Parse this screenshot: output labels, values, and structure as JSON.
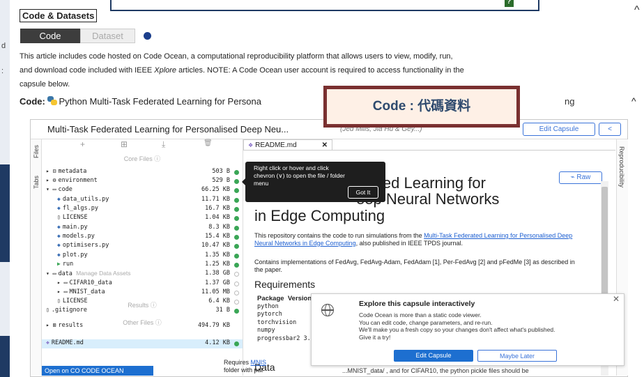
{
  "page": {
    "left_frag_1": "d",
    "left_frag_2": ":",
    "section_title": "Code & Datasets",
    "tabs": {
      "code": "Code",
      "dataset": "Dataset"
    },
    "intro_1": "This article includes code hosted on Code Ocean, a computational reproducibility platform that allows users to view, modify, run,",
    "intro_2a": "and download code included with IEEE ",
    "intro_2b": "Xplore",
    "intro_2c": " articles. NOTE: A Code Ocean user account is required to access functionality in the",
    "intro_3": "capsule below.",
    "code_label": "Code:",
    "code_value": "Python Multi-Task Federated Learning for Persona",
    "code_tail": "ng",
    "overlay_label": "Code : 代碼資料",
    "up_chevron": "^",
    "down_chevron": "^"
  },
  "capsule": {
    "title": "Multi-Task Federated Learning for Personalised Deep Neu...",
    "authors": "(Jed Mills, Jia Hu & Gey...)",
    "edit_capsule": "Edit Capsule",
    "share": "<",
    "rail_files": "Files",
    "rail_tabs": "Tabs",
    "rail_repro": "Reproducibility",
    "open_co": "Open on CO CODE OCEAN"
  },
  "files": {
    "toolbar": [
      "+",
      "⊞",
      "⤓",
      "🗑"
    ],
    "core_label": "Core Files ⓘ",
    "results_label": "Results ⓘ",
    "other_label": "Other Files ⓘ",
    "rows": [
      {
        "icon": "▸ ⊟",
        "name": "metadata",
        "sub": "",
        "size": "503 B",
        "status": "ok",
        "indent": 0
      },
      {
        "icon": "▸ ⚙",
        "name": "environment",
        "sub": "",
        "size": "529 B",
        "status": "ok",
        "indent": 0
      },
      {
        "icon": "▾ ▭",
        "name": "code",
        "sub": "",
        "size": "66.25 KB",
        "status": "ok",
        "indent": 0
      },
      {
        "icon": "◆",
        "name": "data_utils.py",
        "sub": "",
        "size": "11.71 KB",
        "status": "ok",
        "indent": 1,
        "type": "py"
      },
      {
        "icon": "◆",
        "name": "fl_algs.py",
        "sub": "",
        "size": "16.7 KB",
        "status": "ok",
        "indent": 1,
        "type": "py"
      },
      {
        "icon": "▯",
        "name": "LICENSE",
        "sub": "",
        "size": "1.04 KB",
        "status": "ok",
        "indent": 1
      },
      {
        "icon": "◆",
        "name": "main.py",
        "sub": "",
        "size": "8.3 KB",
        "status": "ok",
        "indent": 1,
        "type": "py"
      },
      {
        "icon": "◆",
        "name": "models.py",
        "sub": "",
        "size": "15.4 KB",
        "status": "ok",
        "indent": 1,
        "type": "py"
      },
      {
        "icon": "◆",
        "name": "optimisers.py",
        "sub": "",
        "size": "10.47 KB",
        "status": "ok",
        "indent": 1,
        "type": "py"
      },
      {
        "icon": "◆",
        "name": "plot.py",
        "sub": "",
        "size": "1.35 KB",
        "status": "ok",
        "indent": 1,
        "type": "py"
      },
      {
        "icon": "▶",
        "name": "run",
        "sub": "",
        "size": "1.25 KB",
        "status": "ok",
        "indent": 1,
        "type": "gr"
      },
      {
        "icon": "▾ ▭",
        "name": "data",
        "sub": "Manage Data Assets",
        "size": "1.38 GB",
        "status": "hollow",
        "indent": 0
      },
      {
        "icon": "▸ ▭",
        "name": "CIFAR10_data",
        "sub": "",
        "size": "1.37 GB",
        "status": "hollow",
        "indent": 1
      },
      {
        "icon": "▸ ▭",
        "name": "MNIST_data",
        "sub": "",
        "size": "11.05 MB",
        "status": "hollow",
        "indent": 1
      },
      {
        "icon": "▯",
        "name": "LICENSE",
        "sub": "",
        "size": "6.4 KB",
        "status": "hollow",
        "indent": 1
      },
      {
        "icon": "▯",
        "name": ".gitignore",
        "sub": "",
        "size": "31 B",
        "status": "ok",
        "indent": 0
      },
      {
        "icon": "▸ ⊠",
        "name": "results",
        "sub": "",
        "size": "494.79 KB",
        "status": "none",
        "indent": 0
      },
      {
        "icon": "❖",
        "name": "README.md",
        "sub": "",
        "size": "4.12 KB",
        "status": "ok",
        "indent": 0,
        "type": "md",
        "selected": true
      }
    ]
  },
  "readme": {
    "tab": "README.md",
    "tab_close": "✕",
    "raw": "Raw",
    "h1_line1": "erated Learning for",
    "h1_line2": "eep Neural Networks",
    "h1_line3": "in Edge Computing",
    "p1a": "This repository contains the code to run simulations from the ",
    "p1_link": "Multi-Task Federated Learning for Personalised Deep Neural Networks in Edge Computing",
    "p1b": ", also published in IEEE TPDS journal.",
    "p2": "Contains implementations of FedAvg, FedAvg-Adam, FedAdam [1], Per-FedAvg [2] and pFedMe [3] as described in the paper.",
    "requirements": "Requirements",
    "table_header": [
      "Package",
      "Version"
    ],
    "packages": [
      "python",
      "pytorch",
      "torchvision",
      "numpy",
      "progressbar2"
    ],
    "pkg_last_frag": "progressbar2 3.",
    "data_heading": "Data",
    "data_text_a": "Requires ",
    "data_link": "MNIS",
    "data_text_b": "folder with pat",
    "data_cont": "...MNIST_data/ , and for CIFAR10, the python pickle files should be"
  },
  "tooltip": {
    "text": "Right click or hover and click chevron (∨) to open the file / folder menu",
    "button": "Got It"
  },
  "popup": {
    "title": "Explore this capsule interactively",
    "line1": "Code Ocean is more than a static code viewer.",
    "line2": "You can edit code, change parameters, and re-run.",
    "line3": "We'll make you a fresh copy so your changes don't affect what's published.",
    "line4": "Give it a try!",
    "edit": "Edit Capsule",
    "later": "Maybe Later",
    "close": "✕"
  }
}
